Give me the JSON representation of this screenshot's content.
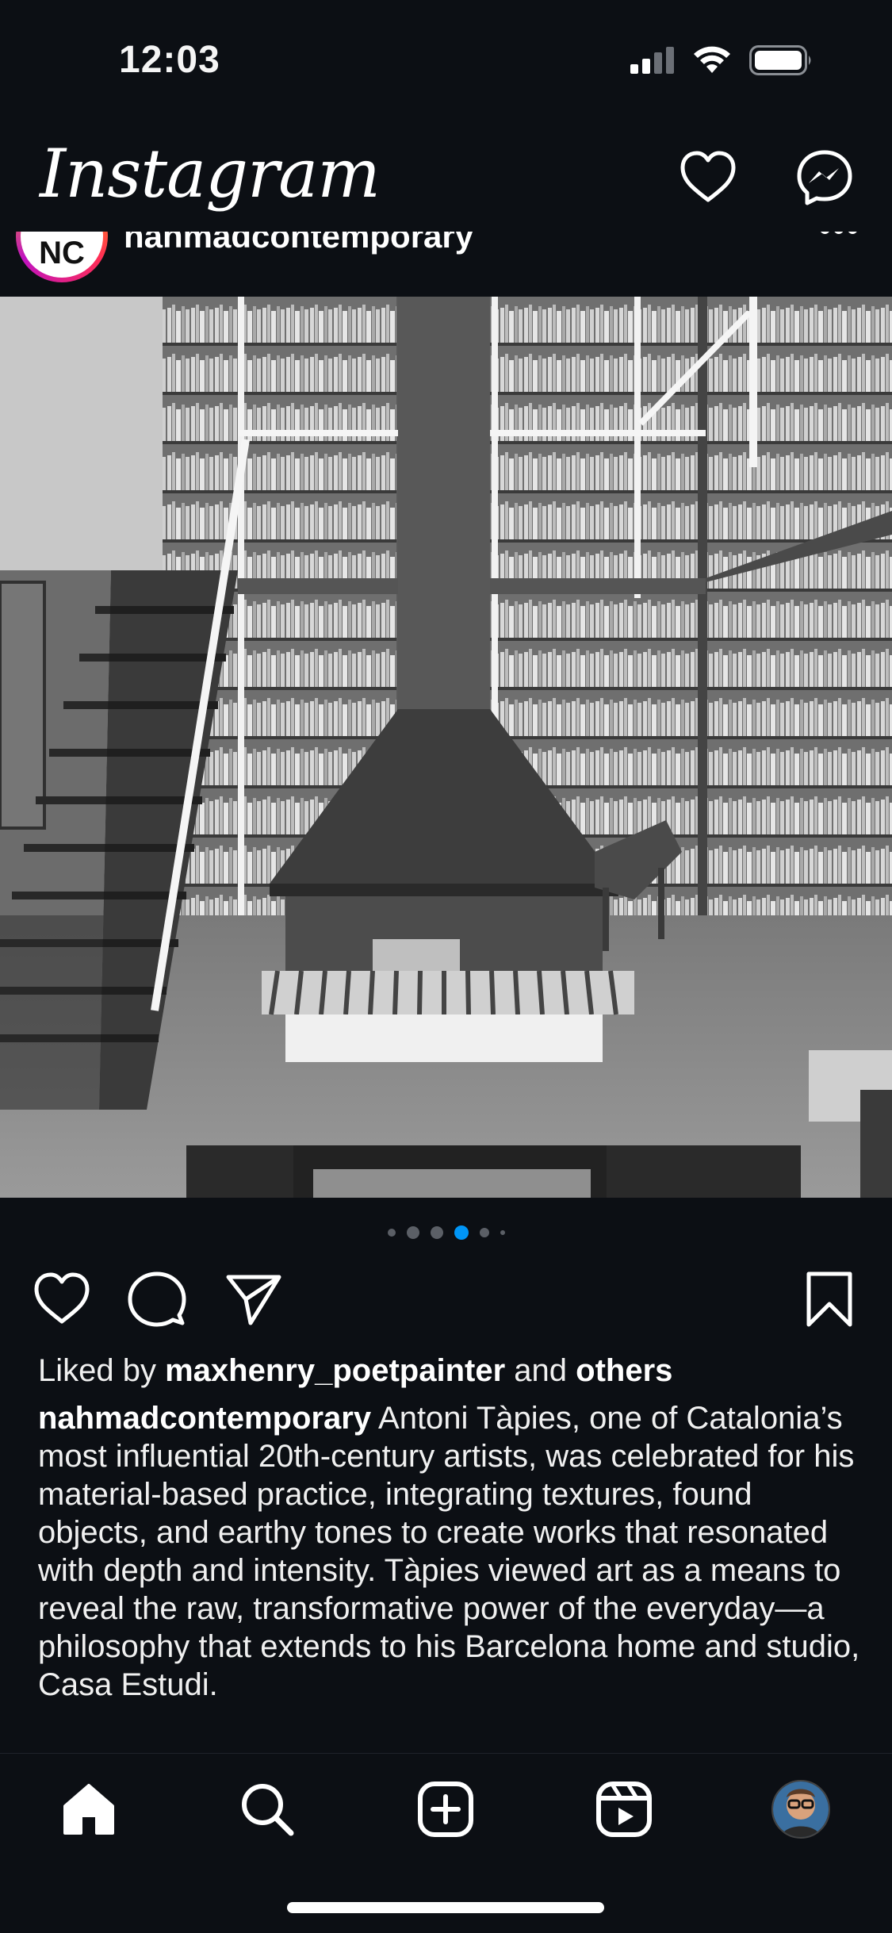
{
  "status_bar": {
    "time": "12:03"
  },
  "header": {
    "brand": "Instagram",
    "icons": [
      "heart-icon",
      "messenger-icon"
    ]
  },
  "post": {
    "avatar_initials": "NC",
    "username": "nahmadcontemporary",
    "more_label": "•••",
    "carousel": {
      "count": 6,
      "active_index": 3
    },
    "likes": {
      "prefix": "Liked by",
      "user": "maxhenry_poetpainter",
      "joiner": "and",
      "others": "others"
    },
    "caption": {
      "user": "nahmadcontemporary",
      "text": "Antoni Tàpies, one of Catalonia’s most influential 20th-century artists, was celebrated for his material-based practice, integrating textures, found objects, and earthy tones to create works that resonated with depth and intensity. Tàpies viewed art as a means to reveal the raw, transformative power of the everyday—a philosophy that extends to his Barcelona home and studio, Casa Estudi."
    }
  },
  "tab_bar": {
    "items": [
      "home-icon",
      "search-icon",
      "create-icon",
      "reels-icon",
      "profile-avatar"
    ]
  },
  "colors": {
    "background": "#0c0f14",
    "accent": "#0095f6",
    "text": "#f5f5f5"
  }
}
